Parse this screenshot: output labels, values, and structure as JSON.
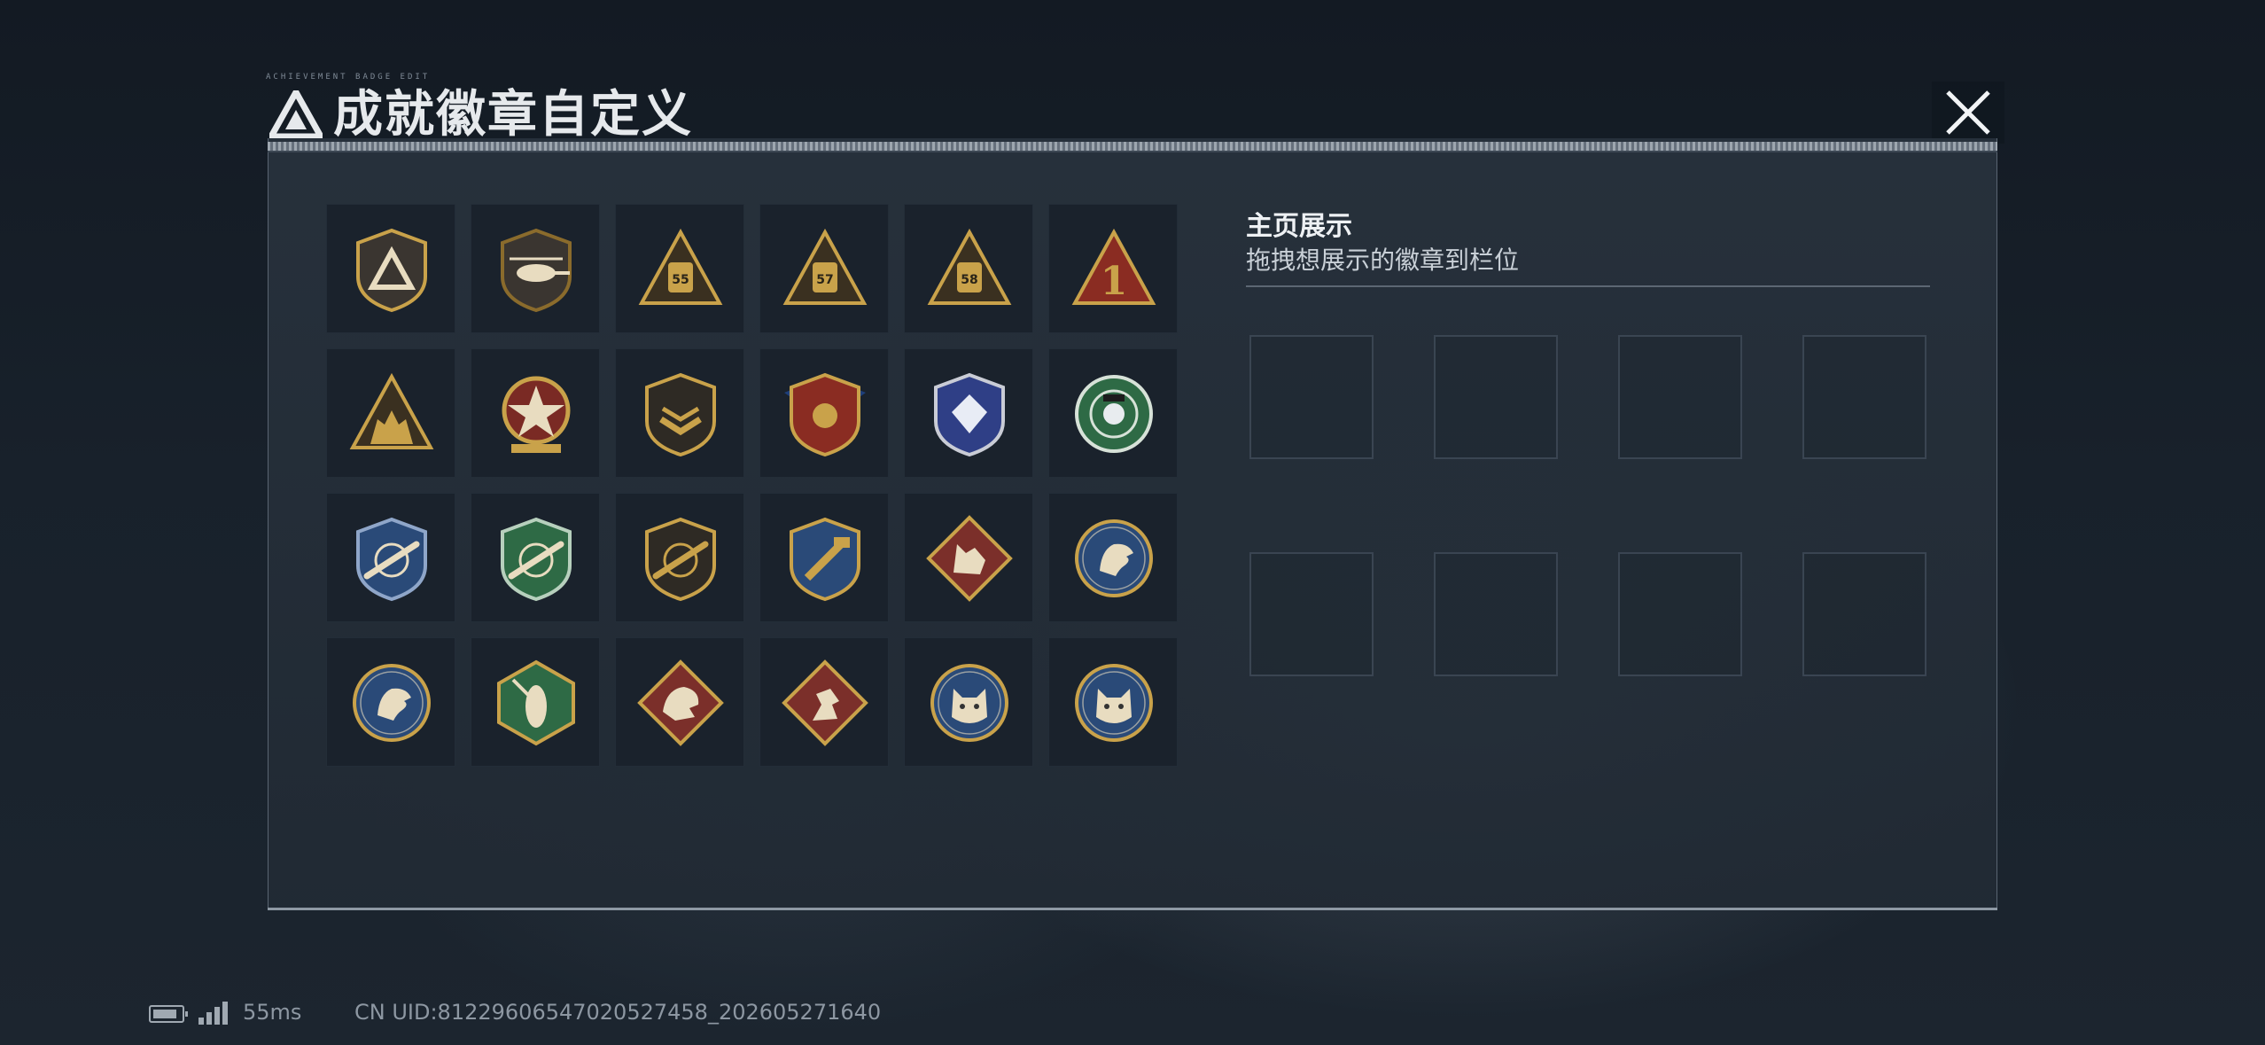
{
  "window": {
    "title": "成就徽章自定义",
    "tiny_caption": "ACHIEVEMENT BADGE EDIT",
    "close_label": "close"
  },
  "colors": {
    "gold": "#c9a24a",
    "panel": "#27313c",
    "slot": "#1a222c",
    "green": "#2e6a45",
    "blue": "#2a4a78",
    "red": "#7b2f2a"
  },
  "badges": [
    {
      "name": "delta-triangle-shield-badge",
      "icon": "shield-triangle"
    },
    {
      "name": "helicopter-shield-badge",
      "icon": "shield-helicopter"
    },
    {
      "name": "rank-55-badge",
      "icon": "triangle-number",
      "number": "55"
    },
    {
      "name": "rank-57-badge",
      "icon": "triangle-number",
      "number": "57"
    },
    {
      "name": "rank-58-badge",
      "icon": "triangle-number",
      "number": "58"
    },
    {
      "name": "rank-1-badge",
      "icon": "triangle-number-red",
      "number": "1"
    },
    {
      "name": "squad-silhouette-badge",
      "icon": "triangle-squad"
    },
    {
      "name": "star-medal-badge",
      "icon": "star-medal"
    },
    {
      "name": "chevron-shield-badge",
      "icon": "shield-chevron"
    },
    {
      "name": "winged-red-shield-badge",
      "icon": "shield-wings-red"
    },
    {
      "name": "diamond-blue-shield-badge",
      "icon": "shield-diamond-blue"
    },
    {
      "name": "skull-crosshair-badge",
      "icon": "circle-skull-green"
    },
    {
      "name": "rifle-blue-shield-badge",
      "icon": "shield-rifle-blue"
    },
    {
      "name": "rifle-green-shield-badge",
      "icon": "shield-rifle-green"
    },
    {
      "name": "rifle-gold-shield-badge",
      "icon": "shield-rifle-gold"
    },
    {
      "name": "hammer-gold-shield-badge",
      "icon": "shield-hammer-gold"
    },
    {
      "name": "wolf-diamond-badge",
      "icon": "diamond-wolf"
    },
    {
      "name": "eagle-circle-badge",
      "icon": "circle-eagle"
    },
    {
      "name": "eagle-circle-badge-2",
      "icon": "circle-eagle"
    },
    {
      "name": "hornet-hexagon-badge",
      "icon": "hex-hornet"
    },
    {
      "name": "dragon-diamond-badge",
      "icon": "diamond-dragon"
    },
    {
      "name": "runner-diamond-badge",
      "icon": "diamond-runner"
    },
    {
      "name": "lynx-circle-badge",
      "icon": "circle-lynx"
    },
    {
      "name": "lynx-circle-badge-2",
      "icon": "circle-lynx"
    }
  ],
  "home_display": {
    "title": "主页展示",
    "subtitle": "拖拽想展示的徽章到栏位",
    "slot_count": 8
  },
  "status_bar": {
    "ping": "55ms",
    "uid": "CN UID:8122960654702052745​8_202605271640"
  }
}
